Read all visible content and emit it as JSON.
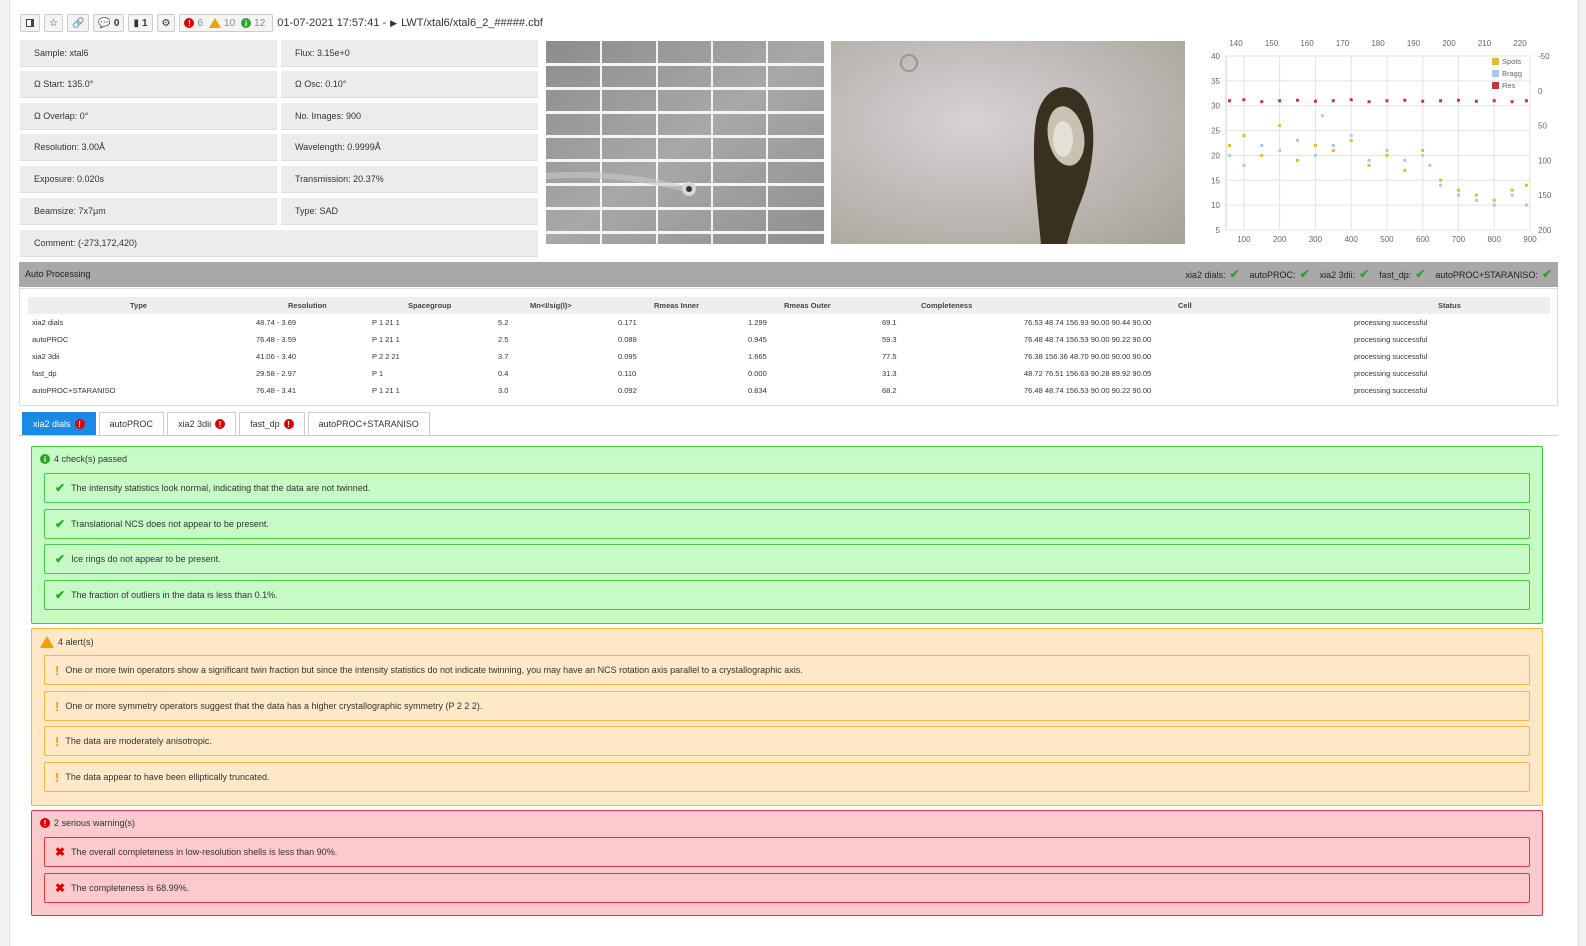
{
  "toolbar": {
    "comments_count": "0",
    "files_count": "1",
    "errors_count": "6",
    "warnings_count": "10",
    "info_count": "12",
    "datetime": "01-07-2021 17:57:41 -",
    "path": "LWT/xtal6/xtal6_2_#####.cbf"
  },
  "meta": {
    "sample": "Sample: xtal6",
    "flux": "Flux: 3.15e+0",
    "omega_start": "Ω Start: 135.0°",
    "omega_osc": "Ω Osc: 0.10°",
    "omega_overlap": "Ω Overlap: 0°",
    "no_images": "No. Images: 900",
    "resolution": "Resolution: 3.00Å",
    "wavelength": "Wavelength: 0.9999Å",
    "exposure": "Exposure: 0.020s",
    "transmission": "Transmission: 20.37%",
    "beamsize": "Beamsize: 7x7μm",
    "type": "Type: SAD",
    "comment": "Comment: (-273,172,420)"
  },
  "chart_data": {
    "type": "scatter",
    "x_bottom_ticks": [
      "100",
      "200",
      "300",
      "400",
      "500",
      "600",
      "700",
      "800",
      "900"
    ],
    "x_top_ticks": [
      "140",
      "150",
      "160",
      "170",
      "180",
      "190",
      "200",
      "210",
      "220"
    ],
    "y_left_ticks": [
      "40",
      "35",
      "30",
      "25",
      "20",
      "15",
      "10",
      "5"
    ],
    "y_right_ticks": [
      "-50",
      "0",
      "50",
      "100",
      "150",
      "200"
    ],
    "xlim": [
      50,
      900
    ],
    "ylim": [
      5,
      40
    ],
    "legend": [
      "Spots",
      "Bragg",
      "Res"
    ],
    "legend_placement": "top-right",
    "colors": {
      "Spots": "#e8b830",
      "Bragg": "#a6cbe8",
      "Res": "#c23838"
    },
    "grid": true,
    "series": [
      {
        "name": "Res",
        "values": [
          [
            60,
            31
          ],
          [
            100,
            31.2
          ],
          [
            150,
            30.8
          ],
          [
            200,
            31
          ],
          [
            250,
            31.1
          ],
          [
            300,
            30.9
          ],
          [
            350,
            31
          ],
          [
            400,
            31.2
          ],
          [
            450,
            30.8
          ],
          [
            500,
            31
          ],
          [
            550,
            31.1
          ],
          [
            600,
            30.9
          ],
          [
            650,
            31
          ],
          [
            700,
            31.1
          ],
          [
            750,
            30.9
          ],
          [
            800,
            31
          ],
          [
            850,
            30.8
          ],
          [
            890,
            31
          ]
        ]
      },
      {
        "name": "Bragg",
        "values": [
          [
            60,
            20
          ],
          [
            100,
            18
          ],
          [
            150,
            22
          ],
          [
            200,
            21
          ],
          [
            250,
            23
          ],
          [
            300,
            20
          ],
          [
            320,
            28
          ],
          [
            350,
            22
          ],
          [
            400,
            24
          ],
          [
            450,
            19
          ],
          [
            500,
            21
          ],
          [
            550,
            19
          ],
          [
            600,
            20
          ],
          [
            620,
            18
          ],
          [
            650,
            14
          ],
          [
            700,
            12
          ],
          [
            750,
            11
          ],
          [
            800,
            10
          ],
          [
            850,
            12
          ],
          [
            890,
            10
          ]
        ]
      },
      {
        "name": "Spots",
        "values": [
          [
            60,
            22
          ],
          [
            100,
            24
          ],
          [
            150,
            20
          ],
          [
            200,
            26
          ],
          [
            250,
            19
          ],
          [
            300,
            22
          ],
          [
            350,
            21
          ],
          [
            400,
            23
          ],
          [
            450,
            18
          ],
          [
            500,
            20
          ],
          [
            550,
            17
          ],
          [
            600,
            21
          ],
          [
            650,
            15
          ],
          [
            700,
            13
          ],
          [
            750,
            12
          ],
          [
            800,
            11
          ],
          [
            850,
            13
          ],
          [
            890,
            14
          ]
        ]
      }
    ]
  },
  "auto_processing": {
    "title": "Auto Processing",
    "status": [
      {
        "label": "xia2 dials:"
      },
      {
        "label": "autoPROC:"
      },
      {
        "label": "xia2 3dii:"
      },
      {
        "label": "fast_dp:"
      },
      {
        "label": "autoPROC+STARANISO:"
      }
    ],
    "headers": [
      "Type",
      "Resolution",
      "Spacegroup",
      "Mn<I/sig(I)>",
      "Rmeas Inner",
      "Rmeas Outer",
      "Completeness",
      "Cell",
      "Status"
    ],
    "rows": [
      [
        "xia2 dials",
        "48.74 - 3.69",
        "P 1 21 1",
        "5.2",
        "0.171",
        "1.299",
        "69.1",
        "76.53 48.74 156.93 90.00 90.44 90.00",
        "processing successful"
      ],
      [
        "autoPROC",
        "76.48 - 3.59",
        "P 1 21 1",
        "2.5",
        "0.088",
        "0.945",
        "59.3",
        "76.48 48.74 156.53 90.00 90.22 90.00",
        "processing successful"
      ],
      [
        "xia2 3dii",
        "41.06 - 3.40",
        "P 2 2 21",
        "3.7",
        "0.095",
        "1.665",
        "77.5",
        "76.38 156.36 48.70 90.00 90.00 90.00",
        "processing successful"
      ],
      [
        "fast_dp",
        "29.58 - 2.97",
        "P 1",
        "0.4",
        "0.110",
        "0.000",
        "31.3",
        "48.72 76.51 156.63 90.28 89.92 90.05",
        "processing successful"
      ],
      [
        "autoPROC+STARANISO",
        "76.48 - 3.41",
        "P 1 21 1",
        "3.0",
        "0.092",
        "0.834",
        "68.2",
        "76.48 48.74 156.53 90.00 90.22 90.00",
        "processing successful"
      ]
    ]
  },
  "tabs": [
    {
      "label": "xia2 dials",
      "alert": true
    },
    {
      "label": "autoPROC",
      "alert": false
    },
    {
      "label": "xia2 3dii",
      "alert": true
    },
    {
      "label": "fast_dp",
      "alert": true
    },
    {
      "label": "autoPROC+STARANISO",
      "alert": false
    }
  ],
  "checks": {
    "passed_title": "4 check(s) passed",
    "passed": [
      "The intensity statistics look normal, indicating that the data are not twinned.",
      "Translational NCS does not appear to be present.",
      "Ice rings do not appear to be present.",
      "The fraction of outliers in the data is less than 0.1%."
    ],
    "alerts_title": "4 alert(s)",
    "alerts": [
      "One or more twin operators show a significant twin fraction but since the intensity statistics do not indicate twinning, you may have an NCS rotation axis parallel to a crystallographic axis.",
      "One or more symmetry operators suggest that the data has a higher crystallographic symmetry (P 2 2 2).",
      "The data are moderately anisotropic.",
      "The data appear to have been elliptically truncated."
    ],
    "warnings_title": "2 serious warning(s)",
    "warnings": [
      "The overall completeness in low-resolution shells is less than 90%.",
      "The completeness is 68.99%."
    ]
  }
}
